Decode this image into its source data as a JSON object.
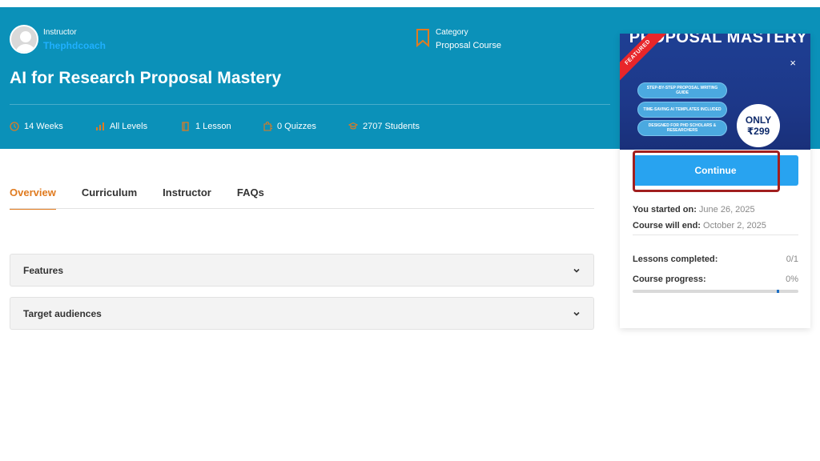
{
  "header": {
    "instructor_label": "Instructor",
    "instructor_name": "Thephdcoach",
    "category_label": "Category",
    "category_value": "Proposal Course",
    "course_title": "AI for Research Proposal Mastery"
  },
  "meta": {
    "duration": "14 Weeks",
    "level": "All Levels",
    "lessons": "1 Lesson",
    "quizzes": "0 Quizzes",
    "students": "2707 Students"
  },
  "tabs": [
    {
      "label": "Overview",
      "active": true
    },
    {
      "label": "Curriculum",
      "active": false
    },
    {
      "label": "Instructor",
      "active": false
    },
    {
      "label": "FAQs",
      "active": false
    }
  ],
  "accordions": [
    {
      "label": "Features"
    },
    {
      "label": "Target audiences"
    }
  ],
  "sidebar": {
    "promo_title": "PROPOSAL MASTERY",
    "featured_badge": "FEATURED",
    "close_symbol": "×",
    "pills": [
      "STEP-BY-STEP PROPOSAL WRITING GUIDE",
      "TIME-SAVING AI TEMPLATES INCLUDED",
      "DESIGNED FOR PHD SCHOLARS & RESEARCHERS"
    ],
    "price_only": "ONLY",
    "price_amount": "₹299",
    "continue_label": "Continue",
    "started_label": "You started on:",
    "started_value": "June 26, 2025",
    "end_label": "Course will end:",
    "end_value": "October 2, 2025",
    "lessons_completed_label": "Lessons completed:",
    "lessons_completed_value": "0/1",
    "progress_label": "Course progress:",
    "progress_value": "0%",
    "progress_fraction": 0
  },
  "colors": {
    "hero_bg": "#0b91b9",
    "accent_orange": "#e07b20",
    "button_blue": "#28a3f0",
    "annotation_red": "#a11f1f"
  },
  "icons": {
    "avatar": "user-avatar-icon",
    "category": "bookmark-icon",
    "duration": "clock-icon",
    "level": "bar-chart-icon",
    "lessons": "book-icon",
    "quizzes": "puzzle-icon",
    "students": "graduation-cap-icon",
    "accordion": "chevron-down-icon",
    "close": "close-icon"
  }
}
